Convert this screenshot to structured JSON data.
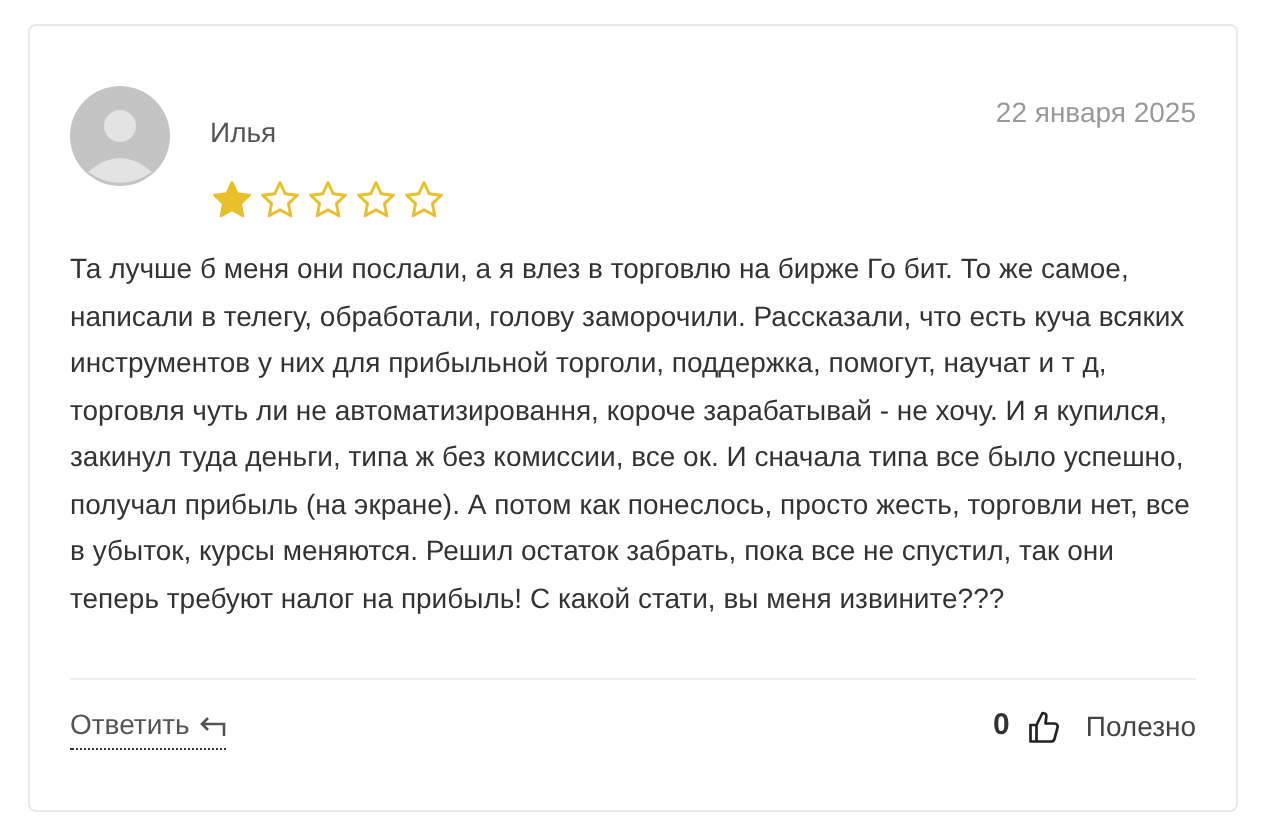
{
  "review": {
    "author": "Илья",
    "date": "22 января 2025",
    "stars": 1,
    "text": "Та лучше б меня они послали, а я влез в торговлю на бирже Го бит. То же самое, написали в телегу, обработали, голову заморочили. Рассказали, что есть куча всяких инструментов у них для прибыльной торголи, поддержка, помогут, научат и т д, торговля чуть ли не автоматизировання, короче зарабатывай - не хочу. И я купился, закинул туда деньги, типа ж без комиссии, все ок. И сначала типа все было успешно, получал прибыль (на экране). А потом как понеслось, просто жесть, торговли нет, все в убыток, курсы меняются. Решил остаток забрать, пока все не спустил, так они теперь требуют налог на прибыль! С какой стати, вы меня извините???",
    "reply_label": "Ответить",
    "likes": "0",
    "helpful_label": "Полезно"
  }
}
